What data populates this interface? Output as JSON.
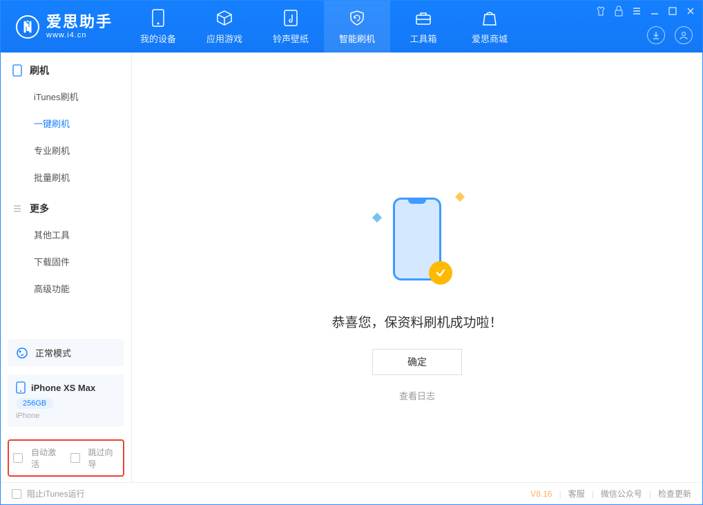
{
  "app": {
    "name": "爱思助手",
    "url": "www.i4.cn"
  },
  "tabs": [
    {
      "label": "我的设备"
    },
    {
      "label": "应用游戏"
    },
    {
      "label": "铃声壁纸"
    },
    {
      "label": "智能刷机"
    },
    {
      "label": "工具箱"
    },
    {
      "label": "爱思商城"
    }
  ],
  "sidebar": {
    "section_flash": "刷机",
    "items_flash": [
      {
        "label": "iTunes刷机"
      },
      {
        "label": "一键刷机"
      },
      {
        "label": "专业刷机"
      },
      {
        "label": "批量刷机"
      }
    ],
    "section_more": "更多",
    "items_more": [
      {
        "label": "其他工具"
      },
      {
        "label": "下载固件"
      },
      {
        "label": "高级功能"
      }
    ]
  },
  "mode": {
    "label": "正常模式"
  },
  "device": {
    "name": "iPhone XS Max",
    "storage": "256GB",
    "type": "iPhone"
  },
  "bottom_opts": {
    "auto_activate": "自动激活",
    "skip_guide": "跳过向导"
  },
  "main": {
    "message": "恭喜您，保资料刷机成功啦！",
    "ok": "确定",
    "view_log": "查看日志"
  },
  "footer": {
    "block_itunes": "阻止iTunes运行",
    "version": "V8.16",
    "support": "客服",
    "wechat": "微信公众号",
    "check_update": "检查更新"
  }
}
